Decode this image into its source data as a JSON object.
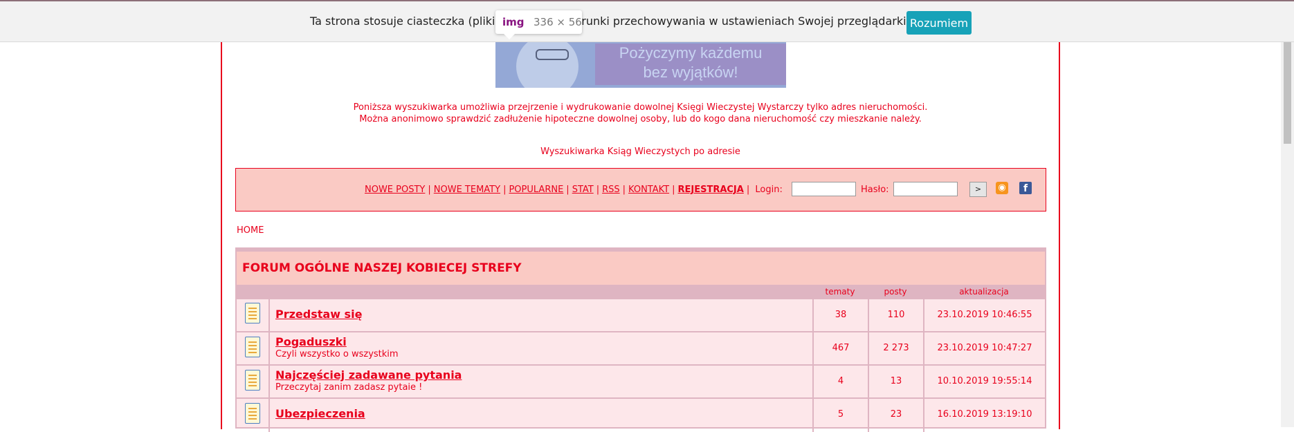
{
  "cookie": {
    "text": "Ta strona stosuje ciasteczka (pliki c             arunki przechowywania w ustawieniach Swojej przeglądarki.",
    "button": "Rozumiem"
  },
  "tooltip": {
    "tag": "img",
    "dims": "336 × 56"
  },
  "banner": {
    "line1": "Pożyczymy każdemu",
    "line2": "bez wyjątków!"
  },
  "intro": {
    "line1": "Poniższa wyszukiwarka umożliwia przejrzenie i wydrukowanie dowolnej Księgi Wieczystej Wystarczy tylko adres nieruchomości.",
    "line2": "Można anonimowo sprawdzić zadłużenie hipoteczne dowolnej osoby, lub do kogo dana nieruchomość czy mieszkanie należy.",
    "link": "Wyszukiwarka Ksiąg Wieczystych po adresie"
  },
  "nav": {
    "links": [
      "NOWE POSTY",
      "NOWE TEMATY",
      "POPULARNE",
      "STAT",
      "RSS",
      "KONTAKT"
    ],
    "register": "REJESTRACJA",
    "login_label": "Login:",
    "password_label": "Hasło:",
    "go": ">",
    "rss_icon": "rss-icon",
    "fb_icon": "facebook-icon"
  },
  "breadcrumb": "HOME",
  "forum": {
    "title": "FORUM OGÓLNE NASZEJ KOBIECEJ STREFY",
    "columns": [
      "tematy",
      "posty",
      "aktualizacja"
    ],
    "rows": [
      {
        "title": "Przedstaw się",
        "desc": "",
        "topics": "38",
        "posts": "110",
        "updated": "23.10.2019 10:46:55"
      },
      {
        "title": "Pogaduszki",
        "desc": "Czyli wszystko o wszystkim",
        "topics": "467",
        "posts": "2 273",
        "updated": "23.10.2019 10:47:27"
      },
      {
        "title": "Najczęściej zadawane pytania",
        "desc": "Przeczytaj zanim zadasz pytaie !",
        "topics": "4",
        "posts": "13",
        "updated": "10.10.2019 19:55:14"
      },
      {
        "title": "Ubezpieczenia",
        "desc": "",
        "topics": "5",
        "posts": "23",
        "updated": "16.10.2019 13:19:10"
      }
    ]
  },
  "colors": {
    "accent": "#e8001c",
    "nav_bg": "#facac4",
    "row_bg": "#fde7ea",
    "header_bg": "#dfb5c2",
    "button": "#17a2b8"
  }
}
